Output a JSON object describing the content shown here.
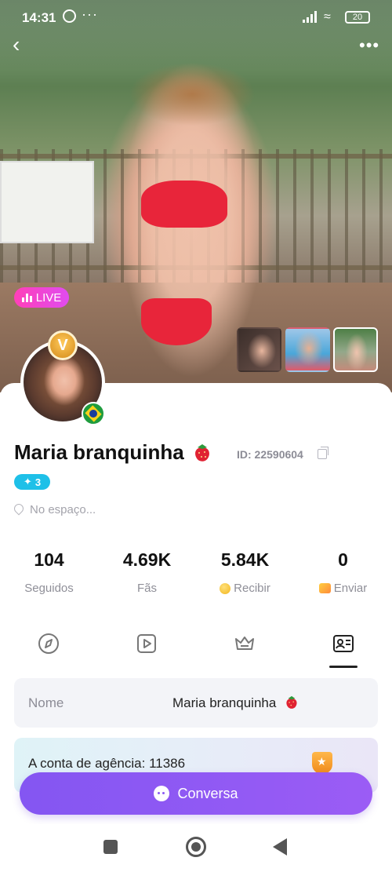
{
  "status_bar": {
    "time": "14:31",
    "more": "···",
    "battery": "20"
  },
  "header": {
    "back_icon": "chevron-left-icon",
    "more_icon": "more-horizontal-icon"
  },
  "hero": {
    "live_label": "LIVE"
  },
  "profile": {
    "name": "Maria branquinha",
    "name_emoji": "🍓",
    "id_text": "ID: 22590604",
    "level": "3",
    "location": "No espaço...",
    "country": "Brazil",
    "badge_letter": "V"
  },
  "stats": [
    {
      "value": "104",
      "label": "Seguidos"
    },
    {
      "value": "4.69K",
      "label": "Fãs"
    },
    {
      "value": "5.84K",
      "label": "Recibir"
    },
    {
      "value": "0",
      "label": "Enviar"
    }
  ],
  "tabs": [
    {
      "icon": "compass-icon",
      "active": false
    },
    {
      "icon": "video-play-icon",
      "active": false
    },
    {
      "icon": "crown-icon",
      "active": false
    },
    {
      "icon": "profile-card-icon",
      "active": true
    }
  ],
  "info": {
    "name_key": "Nome",
    "name_value": "Maria branquinha",
    "agency_text": "A conta de agência: 11386"
  },
  "actions": {
    "chat_label": "Conversa"
  },
  "colors": {
    "live": "#ff3fb8",
    "level": "#1ec0e8",
    "chat_button": "#8a5af3"
  }
}
